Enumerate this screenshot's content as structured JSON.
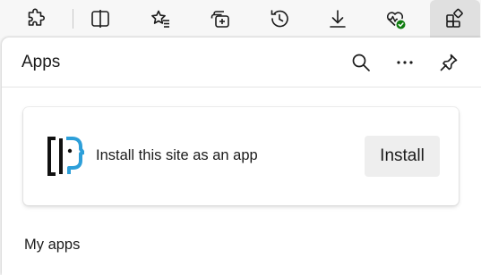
{
  "toolbar": {
    "buttons": [
      {
        "icon": "extensions-icon"
      },
      {
        "icon": "split-screen-icon"
      },
      {
        "icon": "favorites-icon"
      },
      {
        "icon": "collections-icon"
      },
      {
        "icon": "history-icon"
      },
      {
        "icon": "downloads-icon"
      },
      {
        "icon": "browser-essentials-icon",
        "status_color": "#107c10"
      },
      {
        "icon": "apps-icon",
        "active": true
      }
    ]
  },
  "panel": {
    "title": "Apps",
    "header_actions": [
      "search-icon",
      "more-options-icon",
      "pin-icon"
    ]
  },
  "install_card": {
    "message": "Install this site as an app",
    "button_label": "Install",
    "logo_colors": {
      "bracket": "#111111",
      "face": "#2d9fd9"
    }
  },
  "sections": {
    "my_apps_label": "My apps"
  },
  "colors": {
    "toolbar_bg": "#f7f7f7",
    "panel_bg": "#ffffff",
    "active_tab_bg": "#e0e0e0",
    "install_button_bg": "#eeeeee"
  }
}
